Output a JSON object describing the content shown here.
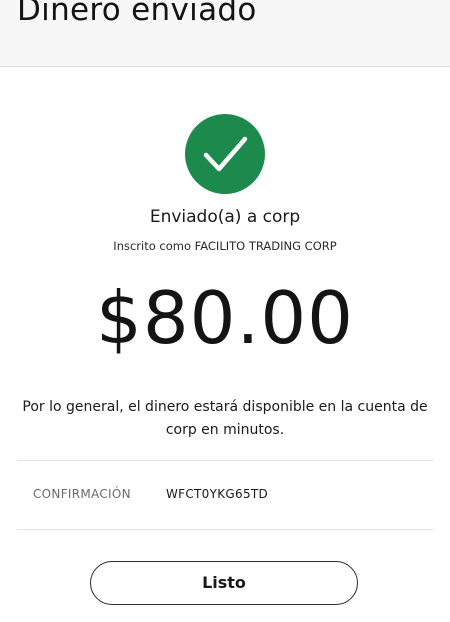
{
  "header": {
    "title": "Dinero enviado"
  },
  "status": {
    "icon": "check-circle-icon",
    "icon_color": "#1d8a4d"
  },
  "recipient": {
    "sent_to": "Enviado(a) a corp",
    "enrolled_as": "Inscrito como FACILITO TRADING CORP"
  },
  "amount": "$80.00",
  "availability_message": "Por lo general, el dinero estará disponible en la cuenta de corp en minutos.",
  "confirmation": {
    "label": "CONFIRMACIÓN",
    "value": "WFCT0YKG65TD"
  },
  "actions": {
    "done_label": "Listo"
  }
}
